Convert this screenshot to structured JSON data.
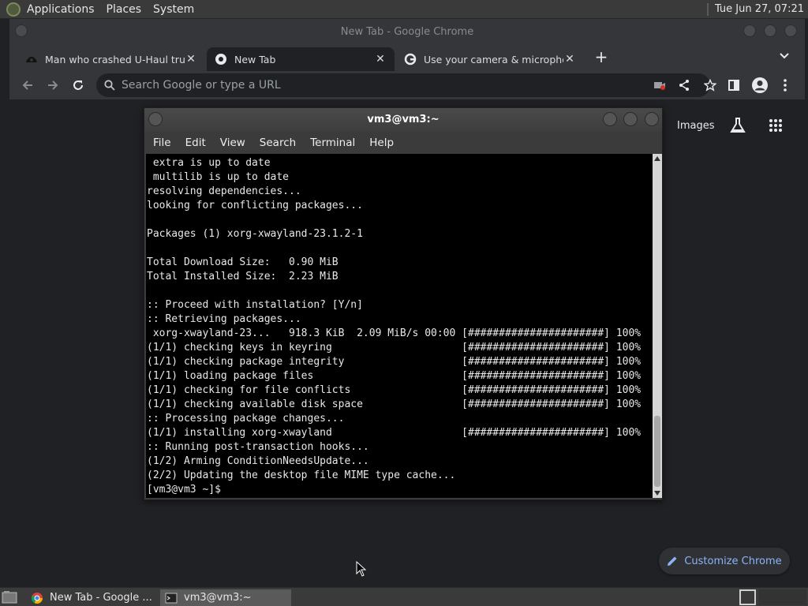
{
  "top_panel": {
    "menus": [
      "Applications",
      "Places",
      "System"
    ],
    "clock": "Tue Jun 27, 07:21"
  },
  "chrome": {
    "window_title": "New Tab - Google Chrome",
    "tabs": [
      {
        "label": "Man who crashed U-Haul truck",
        "favicon": "news-favicon-icon",
        "active": false
      },
      {
        "label": "New Tab",
        "favicon": "chrome-favicon-icon",
        "active": true
      },
      {
        "label": "Use your camera & microphone",
        "favicon": "google-favicon-icon",
        "active": false
      }
    ],
    "omnibox_placeholder": "Search Google or type a URL",
    "content": {
      "images_label": "Images",
      "customize_label": "Customize Chrome"
    }
  },
  "terminal": {
    "title": "vm3@vm3:~",
    "menus": [
      "File",
      "Edit",
      "View",
      "Search",
      "Terminal",
      "Help"
    ],
    "lines": [
      " extra is up to date",
      " multilib is up to date",
      "resolving dependencies...",
      "looking for conflicting packages...",
      "",
      "Packages (1) xorg-xwayland-23.1.2-1",
      "",
      "Total Download Size:   0.90 MiB",
      "Total Installed Size:  2.23 MiB",
      "",
      ":: Proceed with installation? [Y/n]",
      ":: Retrieving packages...",
      " xorg-xwayland-23...   918.3 KiB  2.09 MiB/s 00:00 [######################] 100%",
      "(1/1) checking keys in keyring                     [######################] 100%",
      "(1/1) checking package integrity                   [######################] 100%",
      "(1/1) loading package files                        [######################] 100%",
      "(1/1) checking for file conflicts                  [######################] 100%",
      "(1/1) checking available disk space                [######################] 100%",
      ":: Processing package changes...",
      "(1/1) installing xorg-xwayland                     [######################] 100%",
      ":: Running post-transaction hooks...",
      "(1/2) Arming ConditionNeedsUpdate...",
      "(2/2) Updating the desktop file MIME type cache...",
      "[vm3@vm3 ~]$ "
    ]
  },
  "taskbar": {
    "tasks": [
      {
        "label": "New Tab - Google ...",
        "icon": "chrome-icon",
        "active": false
      },
      {
        "label": "vm3@vm3:~",
        "icon": "terminal-icon",
        "active": true
      }
    ]
  },
  "colors": {
    "accent_blue": "#8ab4f8",
    "chrome_frame": "#35363a",
    "chrome_content": "#202124",
    "terminal_bg": "#000000"
  }
}
